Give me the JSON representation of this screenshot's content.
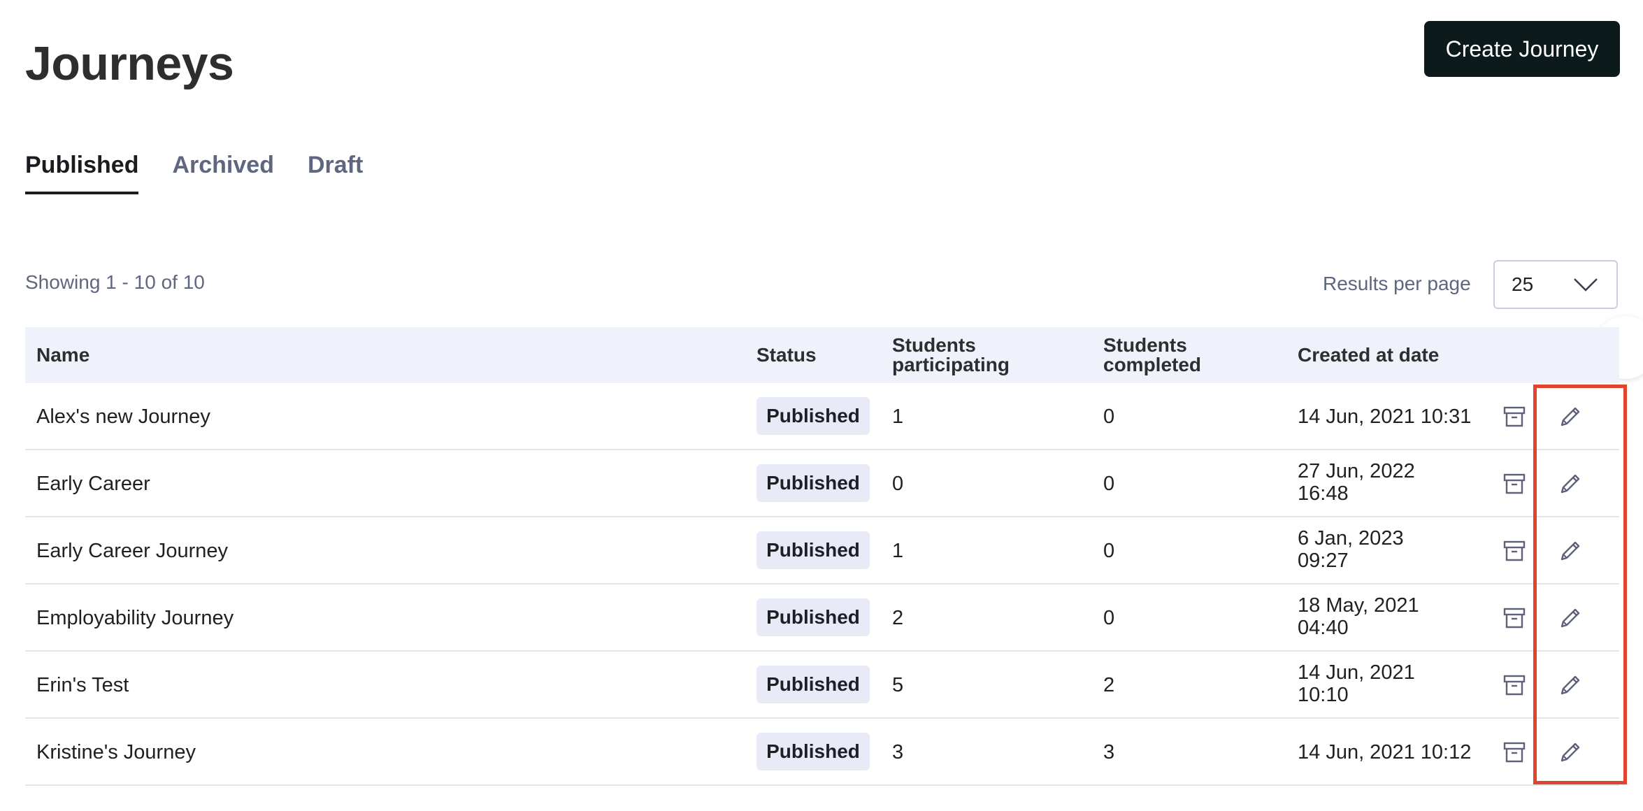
{
  "header": {
    "title": "Journeys",
    "create_label": "Create Journey"
  },
  "tabs": [
    {
      "label": "Published",
      "active": true
    },
    {
      "label": "Archived",
      "active": false
    },
    {
      "label": "Draft",
      "active": false
    }
  ],
  "summary": {
    "showing": "Showing 1 - 10 of 10",
    "results_per_page_label": "Results per page",
    "results_per_page_value": "25"
  },
  "table": {
    "columns": {
      "name": "Name",
      "status": "Status",
      "participating_1": "Students",
      "participating_2": "participating",
      "completed_1": "Students",
      "completed_2": "completed",
      "created": "Created at date"
    },
    "rows": [
      {
        "name": "Alex's new Journey",
        "status": "Published",
        "participating": "1",
        "completed": "0",
        "created_1": "14 Jun, 2021 10:31",
        "created_2": ""
      },
      {
        "name": "Early Career",
        "status": "Published",
        "participating": "0",
        "completed": "0",
        "created_1": "27 Jun, 2022",
        "created_2": "16:48"
      },
      {
        "name": "Early Career Journey",
        "status": "Published",
        "participating": "1",
        "completed": "0",
        "created_1": "6 Jan, 2023",
        "created_2": "09:27"
      },
      {
        "name": "Employability Journey",
        "status": "Published",
        "participating": "2",
        "completed": "0",
        "created_1": "18 May, 2021",
        "created_2": "04:40"
      },
      {
        "name": "Erin's Test",
        "status": "Published",
        "participating": "5",
        "completed": "2",
        "created_1": "14 Jun, 2021",
        "created_2": "10:10"
      },
      {
        "name": "Kristine's Journey",
        "status": "Published",
        "participating": "3",
        "completed": "3",
        "created_1": "14 Jun, 2021 10:12",
        "created_2": ""
      }
    ]
  },
  "icons": {
    "archive": "archive-icon",
    "edit": "pencil-icon",
    "dropdown": "chevron-down-icon"
  },
  "colors": {
    "primary_button": "#0c1a1c",
    "header_row_bg": "#eff2fa",
    "badge_bg": "#e8ebf7",
    "highlight_border": "#e1432c",
    "muted_text": "#5f6680"
  }
}
